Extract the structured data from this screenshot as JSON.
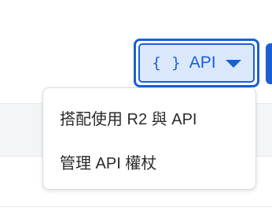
{
  "api_button": {
    "icon": "braces-icon",
    "braces": "{ }",
    "label": "API",
    "caret_icon": "caret-down-icon",
    "accent_color": "#1a5fd6",
    "fill_color": "#dbe8fc"
  },
  "dropdown": {
    "items": [
      {
        "label": "搭配使用 R2 與 API"
      },
      {
        "label": "管理 API 權杖"
      }
    ]
  }
}
